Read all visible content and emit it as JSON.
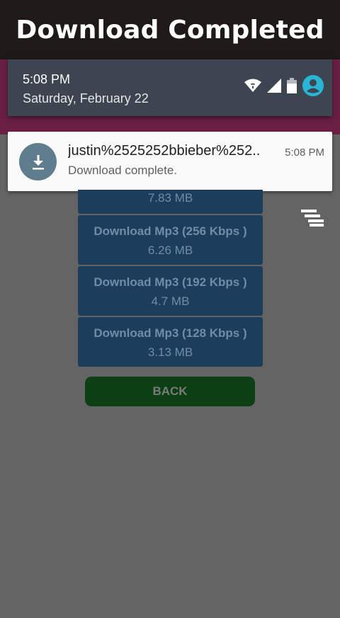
{
  "banner": {
    "title": "Download Completed"
  },
  "status_bar": {
    "time": "5:08 PM",
    "date": "Saturday, February 22",
    "icons": [
      "wifi-icon",
      "signal-icon",
      "battery-icon",
      "account-icon"
    ]
  },
  "notification": {
    "icon": "download-icon",
    "title": "justin%2525252bbieber%252..",
    "time": "5:08 PM",
    "text": "Download complete."
  },
  "downloads": [
    {
      "size": "7.83 MB"
    },
    {
      "label": "Download Mp3 (256 Kbps )",
      "size": "6.26 MB"
    },
    {
      "label": "Download Mp3 (192 Kbps )",
      "size": "4.7 MB"
    },
    {
      "label": "Download Mp3 (128 Kbps )",
      "size": "3.13 MB"
    }
  ],
  "back_label": "BACK",
  "colors": {
    "banner_bg": "#1f1a17",
    "app_bar": "#6a1f45",
    "overlay_bg": "#646464",
    "download_button": "#1d3d5c",
    "back_button": "#0d3f14",
    "notification_icon": "#5f7d8c",
    "account_icon": "#29b6d6"
  }
}
